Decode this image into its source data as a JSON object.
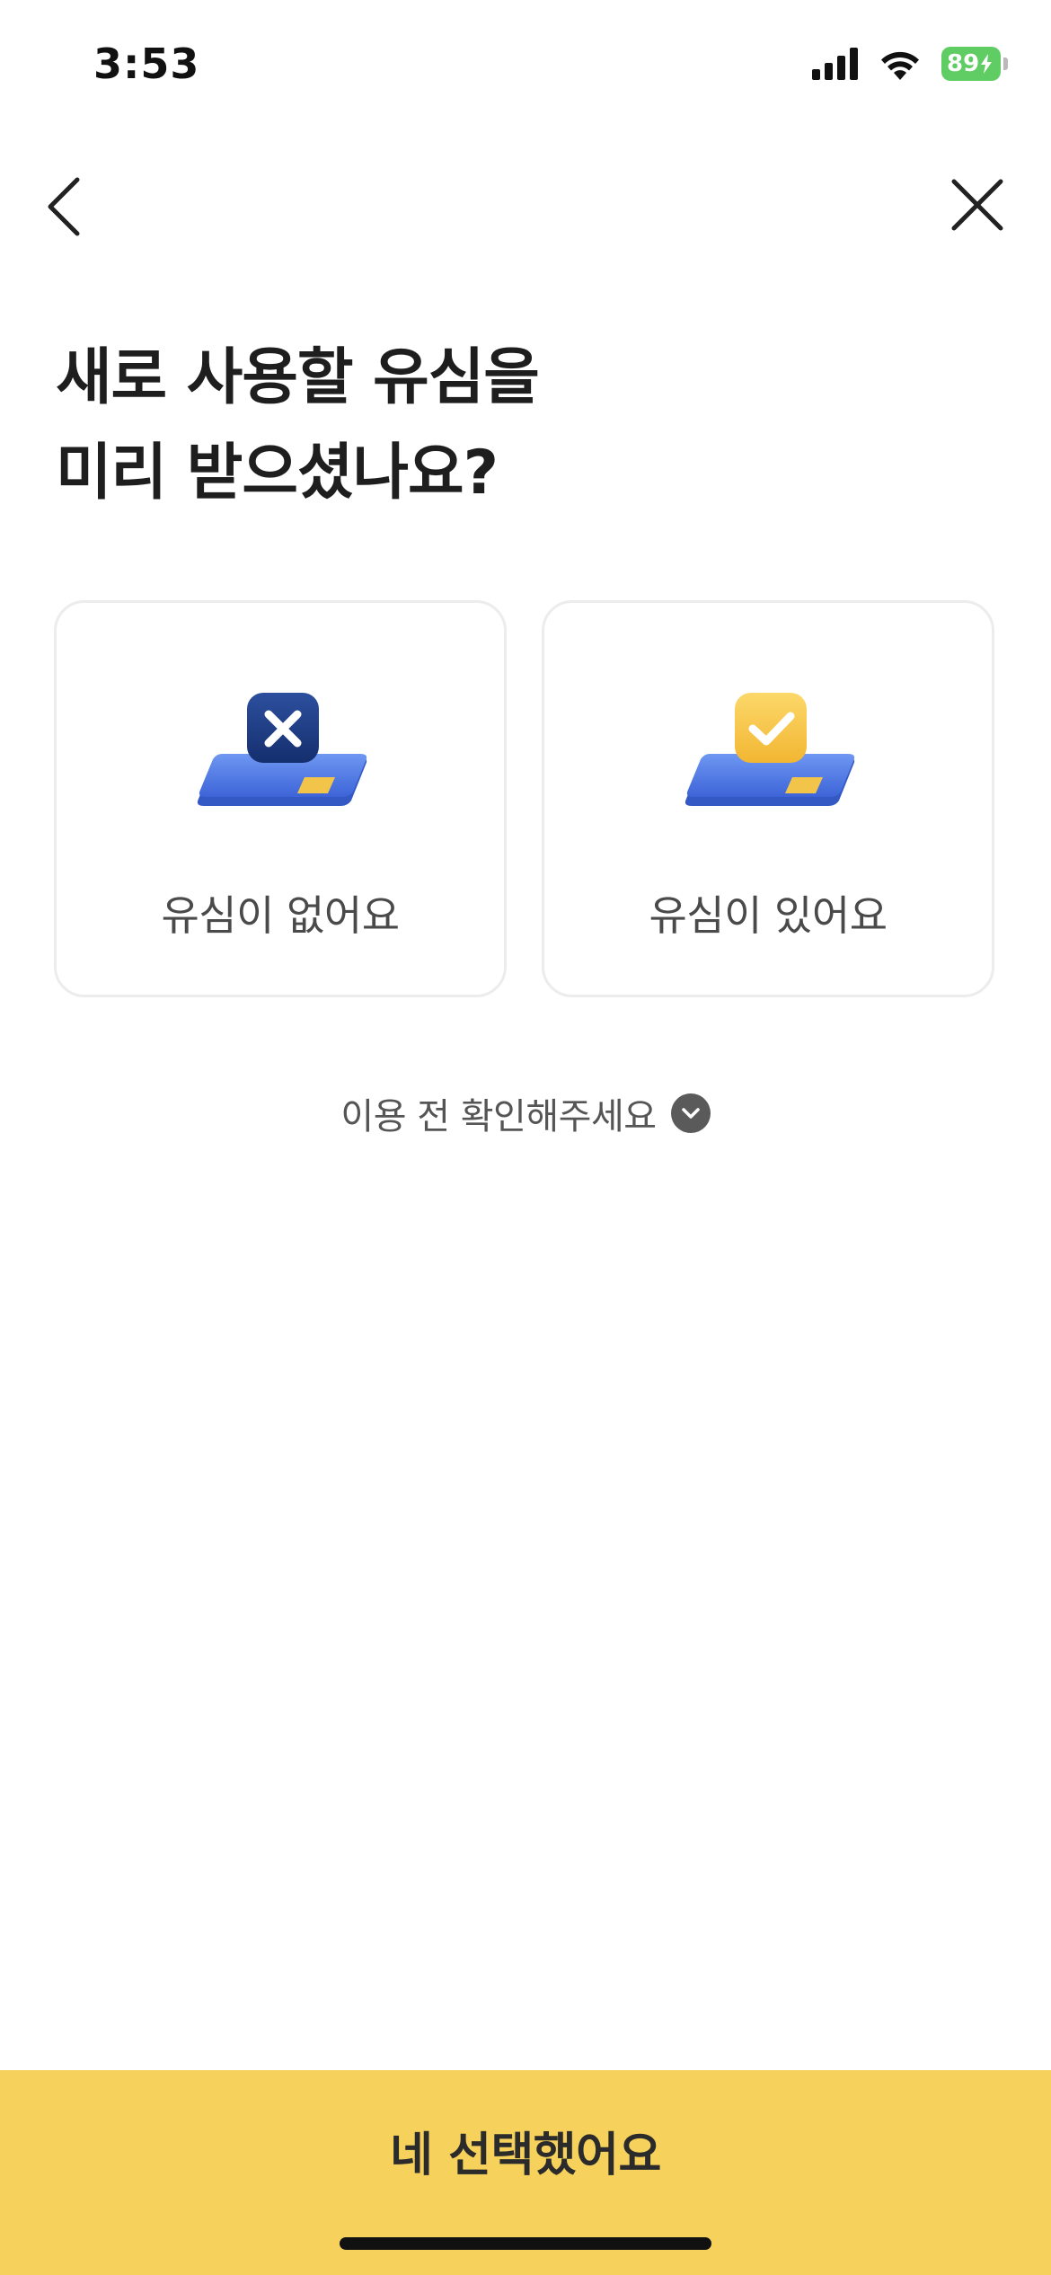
{
  "status_bar": {
    "time": "3:53",
    "battery": "89"
  },
  "nav": {
    "back_icon": "chevron-left-icon",
    "close_icon": "close-icon"
  },
  "title": {
    "line1": "새로 사용할 유심을",
    "line2": "미리 받으셨나요?"
  },
  "options": [
    {
      "label": "유심이 없어요",
      "icon": "sim-x-icon",
      "badge_color": "#1f3c86"
    },
    {
      "label": "유심이 있어요",
      "icon": "sim-check-icon",
      "badge_color": "#f7c948"
    }
  ],
  "notice": {
    "label": "이용 전 확인해주세요",
    "icon": "chevron-down-circle-icon"
  },
  "cta": {
    "label": "네 선택했어요",
    "color": "#f6d25c"
  }
}
